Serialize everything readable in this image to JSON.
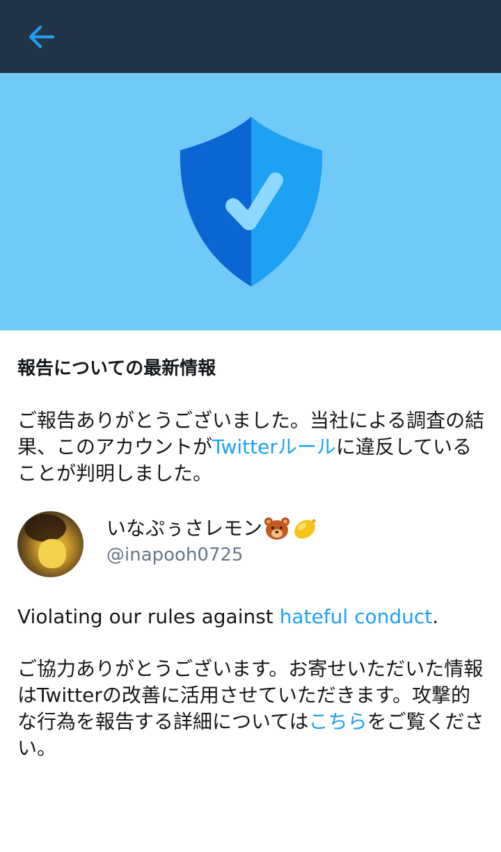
{
  "header": {
    "back_icon": "arrow-left-icon",
    "background": "#243447",
    "accent": "#1da1f2"
  },
  "hero": {
    "icon": "shield-check-icon",
    "background": "#71c9f8"
  },
  "title": "報告についての最新情報",
  "message": {
    "before_link": "ご報告ありがとうございました。当社による調査の結果、このアカウントが",
    "link": "Twitterルール",
    "after_link": "に違反していることが判明しました。"
  },
  "account": {
    "name": "いなぷぅさレモン",
    "name_emojis": [
      "bear-face-icon",
      "lemon-icon"
    ],
    "handle": "@inapooh0725"
  },
  "violation": {
    "before_link": "Violating our rules against ",
    "link": "hateful conduct",
    "after_link": "."
  },
  "thanks": {
    "before_link": "ご協力ありがとうございます。お寄せいただいた情報はTwitterの改善に活用させていただきます。攻撃的な行為を報告する詳細については",
    "link": "こちら",
    "after_link": "をご覧ください。"
  }
}
